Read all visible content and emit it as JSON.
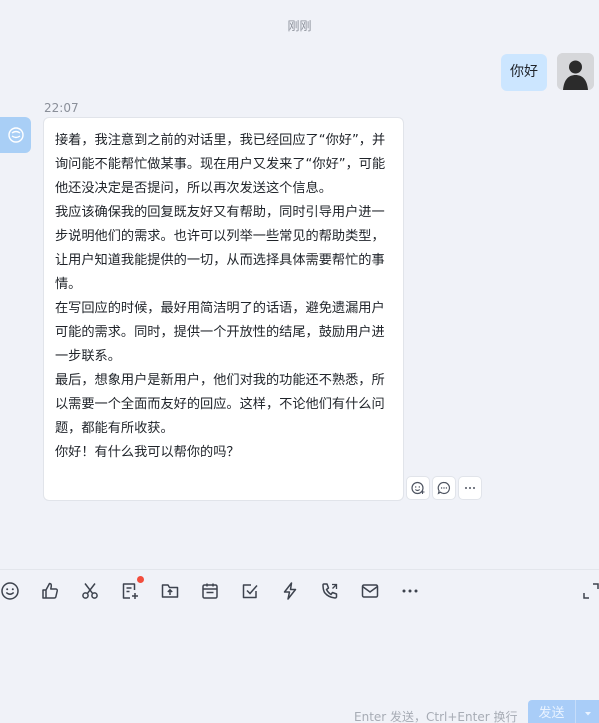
{
  "chat": {
    "time_divider": "刚刚",
    "outgoing": {
      "text": "你好"
    },
    "incoming": {
      "time": "22:07",
      "paragraphs": [
        "接着，我注意到之前的对话里，我已经回应了“你好”，并询问能不能帮忙做某事。现在用户又发来了“你好”，可能他还没决定是否提问，所以再次发送这个信息。",
        "我应该确保我的回复既友好又有帮助，同时引导用户进一步说明他们的需求。也许可以列举一些常见的帮助类型，让用户知道我能提供的一切，从而选择具体需要帮忙的事情。",
        "在写回应的时候，最好用简洁明了的话语，避免遗漏用户可能的需求。同时，提供一个开放性的结尾，鼓励用户进一步联系。",
        "最后，想象用户是新用户，他们对我的功能还不熟悉，所以需要一个全面而友好的回应。这样，不论他们有什么问题，都能有所收获。",
        "你好！有什么我可以帮你的吗？"
      ]
    }
  },
  "input": {
    "hint": "Enter 发送，Ctrl+Enter 换行",
    "send_label": "发送"
  },
  "colors": {
    "background": "#f0f2f8",
    "outgoing_bubble": "#cce6ff",
    "send_button": "#a9cdf8",
    "notification_dot": "#f24d3d"
  },
  "icons": {
    "toolbar": [
      "emoji-icon",
      "thumbs-up-icon",
      "scissors-icon",
      "document-add-icon",
      "folder-upload-icon",
      "calendar-icon",
      "task-check-icon",
      "lightning-icon",
      "phone-call-icon",
      "mail-icon",
      "more-icon",
      "expand-icon"
    ],
    "message_actions": [
      "emoji-reaction-icon",
      "reply-comment-icon",
      "more-options-icon"
    ]
  }
}
